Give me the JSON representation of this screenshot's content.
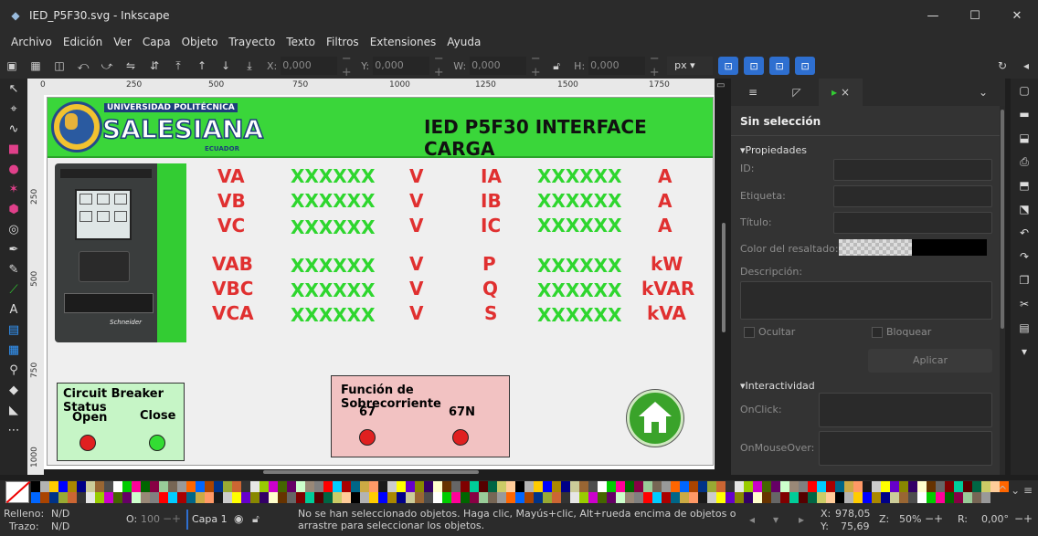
{
  "window": {
    "title": "IED_P5F30.svg - Inkscape",
    "controls": [
      "—",
      "☐",
      "✕"
    ]
  },
  "menu": [
    "Archivo",
    "Edición",
    "Ver",
    "Capa",
    "Objeto",
    "Trayecto",
    "Texto",
    "Filtros",
    "Extensiones",
    "Ayuda"
  ],
  "toolbar": {
    "x_label": "X:",
    "x_value": "0,000",
    "y_label": "Y:",
    "y_value": "0,000",
    "w_label": "W:",
    "w_value": "0,000",
    "h_label": "H:",
    "h_value": "0,000",
    "units": "px ▾"
  },
  "ruler": {
    "top": [
      "0",
      "250",
      "500",
      "750",
      "1000",
      "1250",
      "1500",
      "1750"
    ],
    "left": [
      "250",
      "500",
      "750",
      "1000"
    ]
  },
  "drawing": {
    "logo_small": "UNIVERSIDAD POLITÉCNICA",
    "logo_big": "SALESIANA",
    "logo_tiny": "ECUADOR",
    "title": "IED P5F30 INTERFACE CARGA",
    "device_brand": "Schneider",
    "readings": [
      {
        "label": "VA",
        "value": "XXXXXX",
        "unit": "V",
        "label2": "IA",
        "value2": "XXXXXX",
        "unit2": "A"
      },
      {
        "label": "VB",
        "value": "XXXXXX",
        "unit": "V",
        "label2": "IB",
        "value2": "XXXXXX",
        "unit2": "A"
      },
      {
        "label": "VC",
        "value": "XXXXXX",
        "unit": "V",
        "label2": "IC",
        "value2": "XXXXXX",
        "unit2": "A"
      },
      {
        "label": "VAB",
        "value": "XXXXXX",
        "unit": "V",
        "label2": "P",
        "value2": "XXXXXX",
        "unit2": "kW"
      },
      {
        "label": "VBC",
        "value": "XXXXXX",
        "unit": "V",
        "label2": "Q",
        "value2": "XXXXXX",
        "unit2": "kVAR"
      },
      {
        "label": "VCA",
        "value": "XXXXXX",
        "unit": "V",
        "label2": "S",
        "value2": "XXXXXX",
        "unit2": "kVA"
      }
    ],
    "breaker": {
      "title": "Circuit Breaker Status",
      "open": "Open",
      "close": "Close",
      "open_color": "#e02020",
      "close_color": "#33dd33"
    },
    "protection": {
      "title": "Función de Sobrecorriente",
      "f67": "67",
      "f67n": "67N",
      "led_color": "#e02020"
    }
  },
  "panel": {
    "tab_close": "×",
    "title": "Sin selección",
    "section_props": "▾Propiedades",
    "id_label": "ID:",
    "label_label": "Etiqueta:",
    "title_label": "Título:",
    "highlight_label": "Color del resaltado:",
    "desc_label": "Descripción:",
    "hide_label": "Ocultar",
    "lock_label": "Bloquear",
    "apply_label": "Aplicar",
    "section_inter": "▾Interactividad",
    "onclick_label": "OnClick:",
    "onmouseover_label": "OnMouseOver:"
  },
  "status": {
    "fill_label": "Relleno:",
    "fill_value": "N/D",
    "stroke_label": "Trazo:",
    "stroke_value": "N/D",
    "opacity_label": "O:",
    "opacity_value": "100",
    "layer": "Capa 1",
    "message": "No se han seleccionado objetos. Haga clic, Mayús+clic, Alt+rueda encima de objetos o arrastre para seleccionar los objetos.",
    "x_label": "X:",
    "x_value": "978,05",
    "y_label": "Y:",
    "y_value": "75,69",
    "zoom_label": "Z:",
    "zoom_value": "50%",
    "rot_label": "R:",
    "rot_value": "0,00°"
  }
}
